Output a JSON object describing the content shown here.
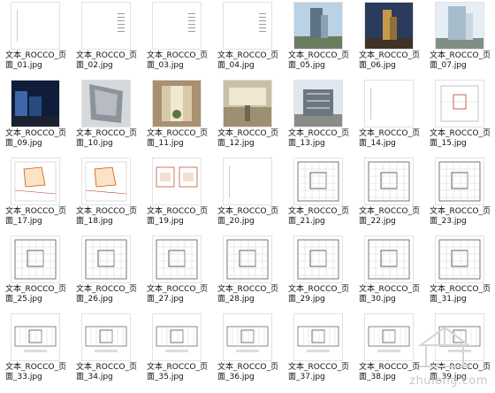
{
  "files": [
    {
      "name": "文本_ROCCO_页面_01.jpg",
      "kind": "blank"
    },
    {
      "name": "文本_ROCCO_页面_02.jpg",
      "kind": "text"
    },
    {
      "name": "文本_ROCCO_页面_03.jpg",
      "kind": "text"
    },
    {
      "name": "文本_ROCCO_页面_04.jpg",
      "kind": "text"
    },
    {
      "name": "文本_ROCCO_页面_05.jpg",
      "kind": "tower-day"
    },
    {
      "name": "文本_ROCCO_页面_06.jpg",
      "kind": "tower-dusk"
    },
    {
      "name": "文本_ROCCO_页面_07.jpg",
      "kind": "tower-glass"
    },
    {
      "name": "文本_ROCCO_页面_09.jpg",
      "kind": "night"
    },
    {
      "name": "文本_ROCCO_页面_10.jpg",
      "kind": "facade"
    },
    {
      "name": "文本_ROCCO_页面_11.jpg",
      "kind": "atrium"
    },
    {
      "name": "文本_ROCCO_页面_12.jpg",
      "kind": "lobby"
    },
    {
      "name": "文本_ROCCO_页面_13.jpg",
      "kind": "street"
    },
    {
      "name": "文本_ROCCO_页面_14.jpg",
      "kind": "blank"
    },
    {
      "name": "文本_ROCCO_页面_15.jpg",
      "kind": "siteplan"
    },
    {
      "name": "文本_ROCCO_页面_17.jpg",
      "kind": "site-red"
    },
    {
      "name": "文本_ROCCO_页面_18.jpg",
      "kind": "site-red"
    },
    {
      "name": "文本_ROCCO_页面_19.jpg",
      "kind": "diagram-pair"
    },
    {
      "name": "文本_ROCCO_页面_20.jpg",
      "kind": "blank"
    },
    {
      "name": "文本_ROCCO_页面_21.jpg",
      "kind": "plan"
    },
    {
      "name": "文本_ROCCO_页面_22.jpg",
      "kind": "plan"
    },
    {
      "name": "文本_ROCCO_页面_23.jpg",
      "kind": "plan"
    },
    {
      "name": "文本_ROCCO_页面_25.jpg",
      "kind": "plan"
    },
    {
      "name": "文本_ROCCO_页面_26.jpg",
      "kind": "plan"
    },
    {
      "name": "文本_ROCCO_页面_27.jpg",
      "kind": "plan"
    },
    {
      "name": "文本_ROCCO_页面_28.jpg",
      "kind": "plan"
    },
    {
      "name": "文本_ROCCO_页面_29.jpg",
      "kind": "plan"
    },
    {
      "name": "文本_ROCCO_页面_30.jpg",
      "kind": "plan"
    },
    {
      "name": "文本_ROCCO_页面_31.jpg",
      "kind": "plan"
    },
    {
      "name": "文本_ROCCO_页面_33.jpg",
      "kind": "wide-plan"
    },
    {
      "name": "文本_ROCCO_页面_34.jpg",
      "kind": "wide-plan"
    },
    {
      "name": "文本_ROCCO_页面_35.jpg",
      "kind": "wide-plan"
    },
    {
      "name": "文本_ROCCO_页面_36.jpg",
      "kind": "wide-plan"
    },
    {
      "name": "文本_ROCCO_页面_37.jpg",
      "kind": "wide-plan"
    },
    {
      "name": "文本_ROCCO_页面_38.jpg",
      "kind": "wide-plan"
    },
    {
      "name": "文本_ROCCO_页面_39.jpg",
      "kind": "wide-plan"
    }
  ],
  "watermark": {
    "text": "zhulong.com",
    "icon": "pavilion-logo"
  }
}
